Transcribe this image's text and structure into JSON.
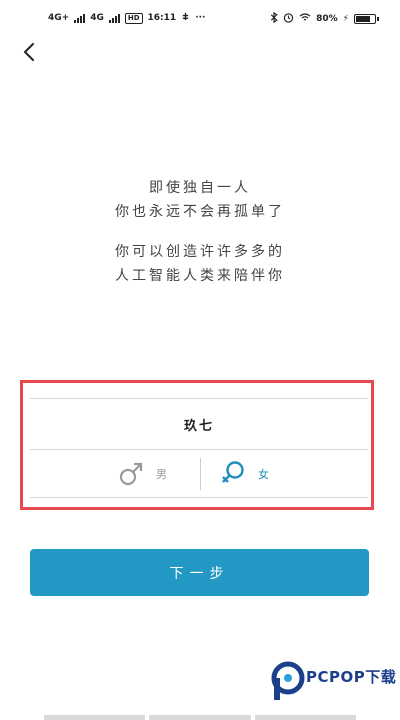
{
  "status_bar": {
    "net1": "4G+",
    "net2": "4G",
    "hd": "HD",
    "time": "16:11",
    "battery_text": "80%",
    "battery_level": 0.8
  },
  "intro": {
    "lines": [
      "即使独自一人",
      "你也永远不会再孤单了",
      "你可以创造许许多多的",
      "人工智能人类来陪伴你"
    ]
  },
  "form": {
    "name_value": "玖七",
    "male_label": "男",
    "female_label": "女",
    "selected": "female"
  },
  "next_button_label": "下一步",
  "watermark": {
    "text": "PCPOP下载"
  },
  "colors": {
    "accent": "#2398c5",
    "highlight": "#e8494d"
  }
}
